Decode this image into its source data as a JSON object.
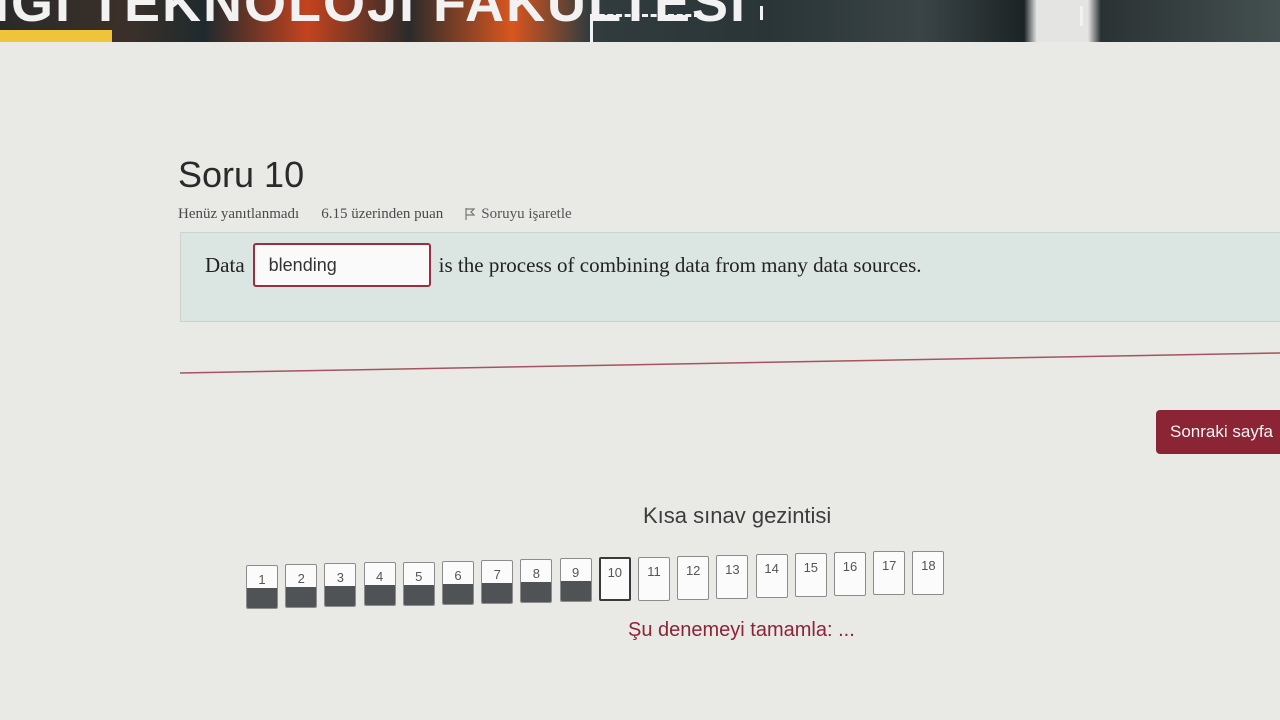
{
  "banner": {
    "text": "IGI TEKNOLOJI FAKULTESI"
  },
  "question": {
    "title": "Soru 10",
    "status": "Henüz yanıtlanmadı",
    "points": "6.15 üzerinden puan",
    "flag_label": "Soruyu işaretle",
    "prefix": "Data",
    "answer_value": "blending",
    "suffix": "is the process of combining data from many data sources."
  },
  "next_button": "Sonraki sayfa",
  "quiz_nav": {
    "title": "Kısa sınav gezintisi",
    "items": [
      {
        "label": "1",
        "state": "answered"
      },
      {
        "label": "2",
        "state": "answered"
      },
      {
        "label": "3",
        "state": "answered"
      },
      {
        "label": "4",
        "state": "answered"
      },
      {
        "label": "5",
        "state": "answered"
      },
      {
        "label": "6",
        "state": "answered"
      },
      {
        "label": "7",
        "state": "answered"
      },
      {
        "label": "8",
        "state": "answered"
      },
      {
        "label": "9",
        "state": "answered"
      },
      {
        "label": "10",
        "state": "current"
      },
      {
        "label": "11",
        "state": "empty"
      },
      {
        "label": "12",
        "state": "empty"
      },
      {
        "label": "13",
        "state": "empty"
      },
      {
        "label": "14",
        "state": "empty"
      },
      {
        "label": "15",
        "state": "empty"
      },
      {
        "label": "16",
        "state": "empty"
      },
      {
        "label": "17",
        "state": "empty"
      },
      {
        "label": "18",
        "state": "empty"
      }
    ],
    "finish_link": "Şu denemeyi tamamla: ..."
  },
  "colors": {
    "accent": "#8b2434",
    "answered": "#505356",
    "question_bg": "#dbe5e1"
  }
}
